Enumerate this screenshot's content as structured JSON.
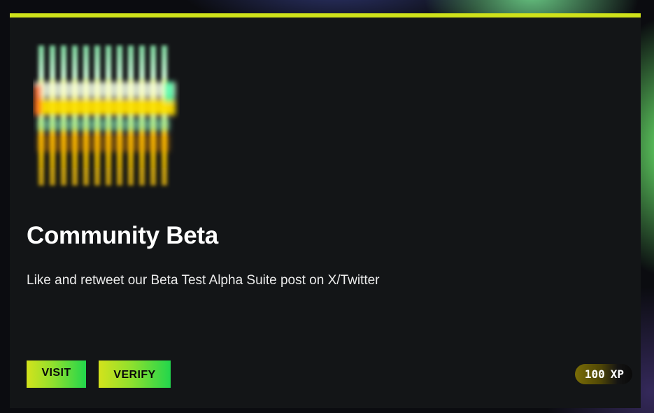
{
  "quest": {
    "title": "Community Beta",
    "description": "Like and retweet our Beta Test Alpha Suite post on X/Twitter",
    "visit_label": "VISIT",
    "verify_label": "VERIFY",
    "reward": {
      "amount": "100",
      "unit": "XP"
    }
  },
  "theme": {
    "accent": "#cfe21a",
    "button_gradient": [
      "#d3e21c",
      "#22d64c"
    ],
    "card_background": "#131517"
  },
  "icons": {
    "artwork": "glitch-bars-logo"
  }
}
